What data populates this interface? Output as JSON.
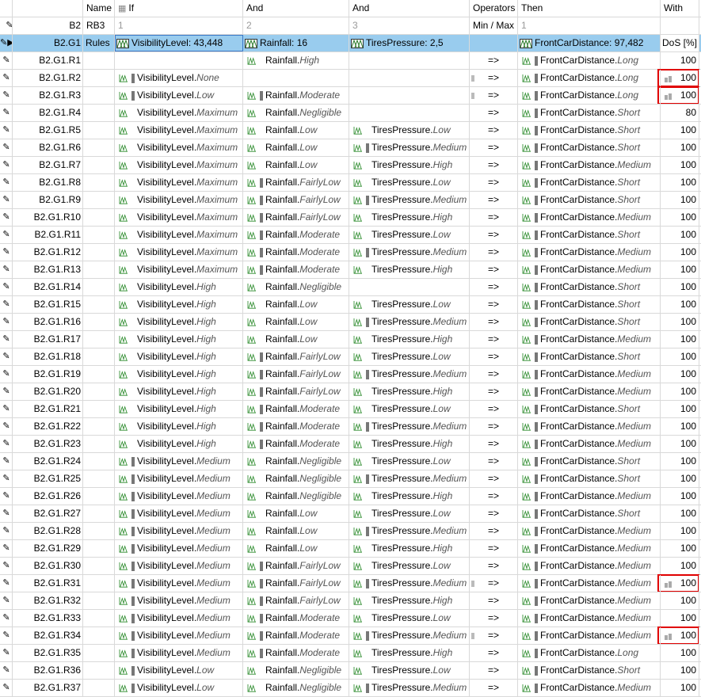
{
  "header": {
    "name": "Name",
    "if": "If",
    "and1": "And",
    "and2": "And",
    "operators": "Operators",
    "then": "Then",
    "with": "With"
  },
  "subheader": {
    "id": "B2",
    "name": "RB3",
    "if": "1",
    "and1": "2",
    "and2": "3",
    "operators": "Min / Max",
    "then": "1"
  },
  "group": {
    "id": "B2.G1",
    "name": "Rules",
    "if": "VisibilityLevel: 43,448",
    "and1": "Rainfall: 16",
    "and2": "TiresPressure: 2,5",
    "then": "FrontCarDistance: 97,482",
    "with": "DoS [%]"
  },
  "rules": [
    {
      "id": "B2.G1.R1",
      "v": "",
      "vt": "",
      "r": "Rainfall",
      "rt": "High",
      "t": "",
      "tt": "",
      "o": "=>",
      "c": "FrontCarDistance",
      "ct": "Long",
      "w": "100"
    },
    {
      "id": "B2.G1.R2",
      "v": "VisibilityLevel",
      "vt": "None",
      "r": "",
      "rt": "",
      "t": "",
      "tt": "",
      "o": "=>",
      "c": "FrontCarDistance",
      "ct": "Long",
      "w": "100"
    },
    {
      "id": "B2.G1.R3",
      "v": "VisibilityLevel",
      "vt": "Low",
      "r": "Rainfall",
      "rt": "Moderate",
      "t": "",
      "tt": "",
      "o": "=>",
      "c": "FrontCarDistance",
      "ct": "Long",
      "w": "100"
    },
    {
      "id": "B2.G1.R4",
      "v": "VisibilityLevel",
      "vt": "Maximum",
      "r": "Rainfall",
      "rt": "Negligible",
      "t": "",
      "tt": "",
      "o": "=>",
      "c": "FrontCarDistance",
      "ct": "Short",
      "w": "80"
    },
    {
      "id": "B2.G1.R5",
      "v": "VisibilityLevel",
      "vt": "Maximum",
      "r": "Rainfall",
      "rt": "Low",
      "t": "TiresPressure",
      "tt": "Low",
      "o": "=>",
      "c": "FrontCarDistance",
      "ct": "Short",
      "w": "100"
    },
    {
      "id": "B2.G1.R6",
      "v": "VisibilityLevel",
      "vt": "Maximum",
      "r": "Rainfall",
      "rt": "Low",
      "t": "TiresPressure",
      "tt": "Medium",
      "o": "=>",
      "c": "FrontCarDistance",
      "ct": "Short",
      "w": "100"
    },
    {
      "id": "B2.G1.R7",
      "v": "VisibilityLevel",
      "vt": "Maximum",
      "r": "Rainfall",
      "rt": "Low",
      "t": "TiresPressure",
      "tt": "High",
      "o": "=>",
      "c": "FrontCarDistance",
      "ct": "Medium",
      "w": "100"
    },
    {
      "id": "B2.G1.R8",
      "v": "VisibilityLevel",
      "vt": "Maximum",
      "r": "Rainfall",
      "rt": "FairlyLow",
      "t": "TiresPressure",
      "tt": "Low",
      "o": "=>",
      "c": "FrontCarDistance",
      "ct": "Short",
      "w": "100"
    },
    {
      "id": "B2.G1.R9",
      "v": "VisibilityLevel",
      "vt": "Maximum",
      "r": "Rainfall",
      "rt": "FairlyLow",
      "t": "TiresPressure",
      "tt": "Medium",
      "o": "=>",
      "c": "FrontCarDistance",
      "ct": "Short",
      "w": "100"
    },
    {
      "id": "B2.G1.R10",
      "v": "VisibilityLevel",
      "vt": "Maximum",
      "r": "Rainfall",
      "rt": "FairlyLow",
      "t": "TiresPressure",
      "tt": "High",
      "o": "=>",
      "c": "FrontCarDistance",
      "ct": "Medium",
      "w": "100"
    },
    {
      "id": "B2.G1.R11",
      "v": "VisibilityLevel",
      "vt": "Maximum",
      "r": "Rainfall",
      "rt": "Moderate",
      "t": "TiresPressure",
      "tt": "Low",
      "o": "=>",
      "c": "FrontCarDistance",
      "ct": "Short",
      "w": "100"
    },
    {
      "id": "B2.G1.R12",
      "v": "VisibilityLevel",
      "vt": "Maximum",
      "r": "Rainfall",
      "rt": "Moderate",
      "t": "TiresPressure",
      "tt": "Medium",
      "o": "=>",
      "c": "FrontCarDistance",
      "ct": "Medium",
      "w": "100"
    },
    {
      "id": "B2.G1.R13",
      "v": "VisibilityLevel",
      "vt": "Maximum",
      "r": "Rainfall",
      "rt": "Moderate",
      "t": "TiresPressure",
      "tt": "High",
      "o": "=>",
      "c": "FrontCarDistance",
      "ct": "Medium",
      "w": "100"
    },
    {
      "id": "B2.G1.R14",
      "v": "VisibilityLevel",
      "vt": "High",
      "r": "Rainfall",
      "rt": "Negligible",
      "t": "",
      "tt": "",
      "o": "=>",
      "c": "FrontCarDistance",
      "ct": "Short",
      "w": "100"
    },
    {
      "id": "B2.G1.R15",
      "v": "VisibilityLevel",
      "vt": "High",
      "r": "Rainfall",
      "rt": "Low",
      "t": "TiresPressure",
      "tt": "Low",
      "o": "=>",
      "c": "FrontCarDistance",
      "ct": "Short",
      "w": "100"
    },
    {
      "id": "B2.G1.R16",
      "v": "VisibilityLevel",
      "vt": "High",
      "r": "Rainfall",
      "rt": "Low",
      "t": "TiresPressure",
      "tt": "Medium",
      "o": "=>",
      "c": "FrontCarDistance",
      "ct": "Short",
      "w": "100"
    },
    {
      "id": "B2.G1.R17",
      "v": "VisibilityLevel",
      "vt": "High",
      "r": "Rainfall",
      "rt": "Low",
      "t": "TiresPressure",
      "tt": "High",
      "o": "=>",
      "c": "FrontCarDistance",
      "ct": "Medium",
      "w": "100"
    },
    {
      "id": "B2.G1.R18",
      "v": "VisibilityLevel",
      "vt": "High",
      "r": "Rainfall",
      "rt": "FairlyLow",
      "t": "TiresPressure",
      "tt": "Low",
      "o": "=>",
      "c": "FrontCarDistance",
      "ct": "Short",
      "w": "100"
    },
    {
      "id": "B2.G1.R19",
      "v": "VisibilityLevel",
      "vt": "High",
      "r": "Rainfall",
      "rt": "FairlyLow",
      "t": "TiresPressure",
      "tt": "Medium",
      "o": "=>",
      "c": "FrontCarDistance",
      "ct": "Medium",
      "w": "100"
    },
    {
      "id": "B2.G1.R20",
      "v": "VisibilityLevel",
      "vt": "High",
      "r": "Rainfall",
      "rt": "FairlyLow",
      "t": "TiresPressure",
      "tt": "High",
      "o": "=>",
      "c": "FrontCarDistance",
      "ct": "Medium",
      "w": "100"
    },
    {
      "id": "B2.G1.R21",
      "v": "VisibilityLevel",
      "vt": "High",
      "r": "Rainfall",
      "rt": "Moderate",
      "t": "TiresPressure",
      "tt": "Low",
      "o": "=>",
      "c": "FrontCarDistance",
      "ct": "Short",
      "w": "100"
    },
    {
      "id": "B2.G1.R22",
      "v": "VisibilityLevel",
      "vt": "High",
      "r": "Rainfall",
      "rt": "Moderate",
      "t": "TiresPressure",
      "tt": "Medium",
      "o": "=>",
      "c": "FrontCarDistance",
      "ct": "Medium",
      "w": "100"
    },
    {
      "id": "B2.G1.R23",
      "v": "VisibilityLevel",
      "vt": "High",
      "r": "Rainfall",
      "rt": "Moderate",
      "t": "TiresPressure",
      "tt": "High",
      "o": "=>",
      "c": "FrontCarDistance",
      "ct": "Medium",
      "w": "100"
    },
    {
      "id": "B2.G1.R24",
      "v": "VisibilityLevel",
      "vt": "Medium",
      "r": "Rainfall",
      "rt": "Negligible",
      "t": "TiresPressure",
      "tt": "Low",
      "o": "=>",
      "c": "FrontCarDistance",
      "ct": "Short",
      "w": "100"
    },
    {
      "id": "B2.G1.R25",
      "v": "VisibilityLevel",
      "vt": "Medium",
      "r": "Rainfall",
      "rt": "Negligible",
      "t": "TiresPressure",
      "tt": "Medium",
      "o": "=>",
      "c": "FrontCarDistance",
      "ct": "Short",
      "w": "100"
    },
    {
      "id": "B2.G1.R26",
      "v": "VisibilityLevel",
      "vt": "Medium",
      "r": "Rainfall",
      "rt": "Negligible",
      "t": "TiresPressure",
      "tt": "High",
      "o": "=>",
      "c": "FrontCarDistance",
      "ct": "Medium",
      "w": "100"
    },
    {
      "id": "B2.G1.R27",
      "v": "VisibilityLevel",
      "vt": "Medium",
      "r": "Rainfall",
      "rt": "Low",
      "t": "TiresPressure",
      "tt": "Low",
      "o": "=>",
      "c": "FrontCarDistance",
      "ct": "Short",
      "w": "100"
    },
    {
      "id": "B2.G1.R28",
      "v": "VisibilityLevel",
      "vt": "Medium",
      "r": "Rainfall",
      "rt": "Low",
      "t": "TiresPressure",
      "tt": "Medium",
      "o": "=>",
      "c": "FrontCarDistance",
      "ct": "Medium",
      "w": "100"
    },
    {
      "id": "B2.G1.R29",
      "v": "VisibilityLevel",
      "vt": "Medium",
      "r": "Rainfall",
      "rt": "Low",
      "t": "TiresPressure",
      "tt": "High",
      "o": "=>",
      "c": "FrontCarDistance",
      "ct": "Medium",
      "w": "100"
    },
    {
      "id": "B2.G1.R30",
      "v": "VisibilityLevel",
      "vt": "Medium",
      "r": "Rainfall",
      "rt": "FairlyLow",
      "t": "TiresPressure",
      "tt": "Low",
      "o": "=>",
      "c": "FrontCarDistance",
      "ct": "Medium",
      "w": "100"
    },
    {
      "id": "B2.G1.R31",
      "v": "VisibilityLevel",
      "vt": "Medium",
      "r": "Rainfall",
      "rt": "FairlyLow",
      "t": "TiresPressure",
      "tt": "Medium",
      "o": "=>",
      "c": "FrontCarDistance",
      "ct": "Medium",
      "w": "100"
    },
    {
      "id": "B2.G1.R32",
      "v": "VisibilityLevel",
      "vt": "Medium",
      "r": "Rainfall",
      "rt": "FairlyLow",
      "t": "TiresPressure",
      "tt": "High",
      "o": "=>",
      "c": "FrontCarDistance",
      "ct": "Medium",
      "w": "100"
    },
    {
      "id": "B2.G1.R33",
      "v": "VisibilityLevel",
      "vt": "Medium",
      "r": "Rainfall",
      "rt": "Moderate",
      "t": "TiresPressure",
      "tt": "Low",
      "o": "=>",
      "c": "FrontCarDistance",
      "ct": "Medium",
      "w": "100"
    },
    {
      "id": "B2.G1.R34",
      "v": "VisibilityLevel",
      "vt": "Medium",
      "r": "Rainfall",
      "rt": "Moderate",
      "t": "TiresPressure",
      "tt": "Medium",
      "o": "=>",
      "c": "FrontCarDistance",
      "ct": "Medium",
      "w": "100"
    },
    {
      "id": "B2.G1.R35",
      "v": "VisibilityLevel",
      "vt": "Medium",
      "r": "Rainfall",
      "rt": "Moderate",
      "t": "TiresPressure",
      "tt": "High",
      "o": "=>",
      "c": "FrontCarDistance",
      "ct": "Long",
      "w": "100"
    },
    {
      "id": "B2.G1.R36",
      "v": "VisibilityLevel",
      "vt": "Low",
      "r": "Rainfall",
      "rt": "Negligible",
      "t": "TiresPressure",
      "tt": "Low",
      "o": "=>",
      "c": "FrontCarDistance",
      "ct": "Short",
      "w": "100"
    },
    {
      "id": "B2.G1.R37",
      "v": "VisibilityLevel",
      "vt": "Low",
      "r": "Rainfall",
      "rt": "Negligible",
      "t": "TiresPressure",
      "tt": "Medium",
      "o": "=>",
      "c": "FrontCarDistance",
      "ct": "Medium",
      "w": "100"
    }
  ]
}
